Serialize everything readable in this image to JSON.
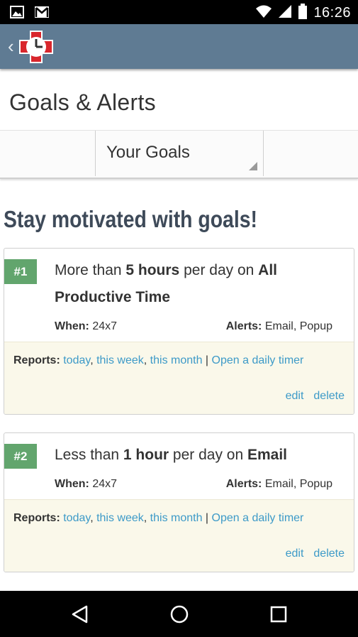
{
  "status_bar": {
    "time": "16:26",
    "icons": [
      "image-icon",
      "gmail-icon",
      "wifi-icon",
      "signal-icon",
      "battery-icon"
    ]
  },
  "app_bar": {
    "back_icon": "chevron-left-icon",
    "logo_icon": "rescuetime-logo-icon"
  },
  "page": {
    "title": "Goals & Alerts"
  },
  "tab_select": {
    "selected": "Your Goals"
  },
  "headline": "Stay motivated with goals!",
  "goals": [
    {
      "badge": "#1",
      "text_prefix": "More than ",
      "amount": "5 hours",
      "text_mid": " per day on ",
      "category": "All Productive Time",
      "when_label": "When:",
      "when_value": " 24x7",
      "alerts_label": "Alerts:",
      "alerts_value": " Email, Popup",
      "reports_label": "Reports:",
      "report_today": "today",
      "report_week": "this week",
      "report_month": "this month",
      "open_timer": "Open a daily timer",
      "edit": "edit",
      "delete": "delete"
    },
    {
      "badge": "#2",
      "text_prefix": "Less than ",
      "amount": "1 hour",
      "text_mid": " per day on ",
      "category": "Email",
      "when_label": "When:",
      "when_value": " 24x7",
      "alerts_label": "Alerts:",
      "alerts_value": " Email, Popup",
      "reports_label": "Reports:",
      "report_today": "today",
      "report_week": "this week",
      "report_month": "this month",
      "open_timer": "Open a daily timer",
      "edit": "edit",
      "delete": "delete"
    }
  ],
  "colors": {
    "app_bar": "#5f7b93",
    "badge": "#62a56d",
    "link": "#3d9ac8",
    "headline": "#3e4a59",
    "reports_bg": "#faf8ea"
  },
  "nav_bar": {
    "icons": [
      "back-triangle-icon",
      "home-circle-icon",
      "recents-square-icon"
    ]
  }
}
